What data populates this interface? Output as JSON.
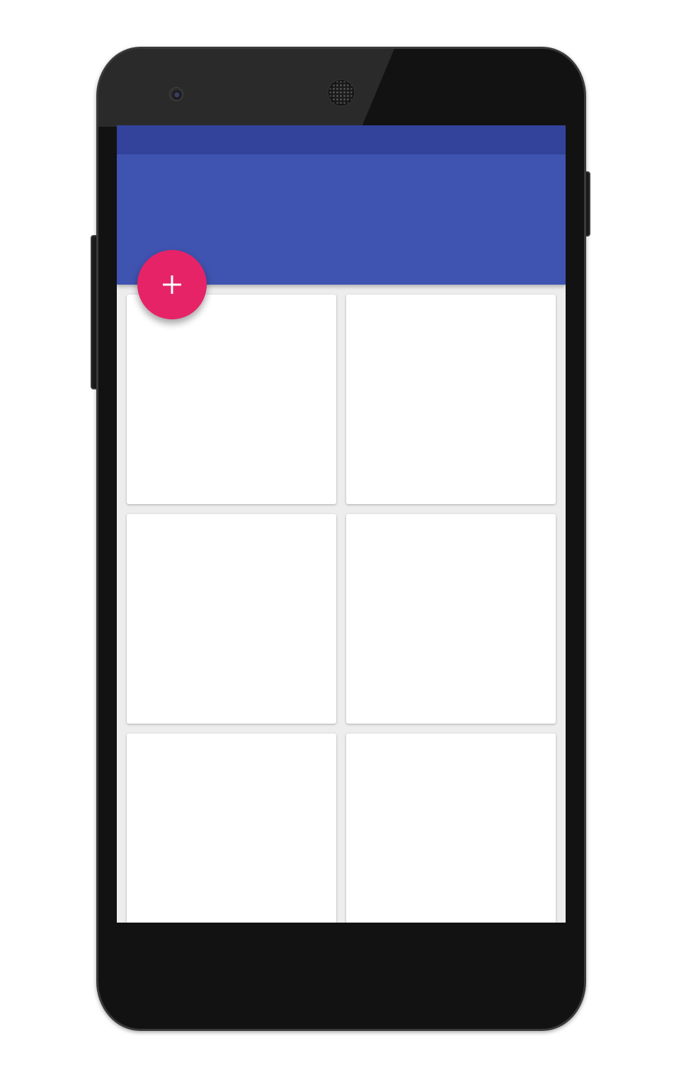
{
  "theme": {
    "status_bar_color": "#33439b",
    "app_bar_color": "#3f53b0",
    "fab_color": "#e62367",
    "background_color": "#ededed",
    "card_color": "#ffffff"
  },
  "fab": {
    "icon": "plus-icon"
  },
  "cards": [
    {
      "id": "card-1"
    },
    {
      "id": "card-2"
    },
    {
      "id": "card-3"
    },
    {
      "id": "card-4"
    },
    {
      "id": "card-5"
    },
    {
      "id": "card-6"
    }
  ]
}
